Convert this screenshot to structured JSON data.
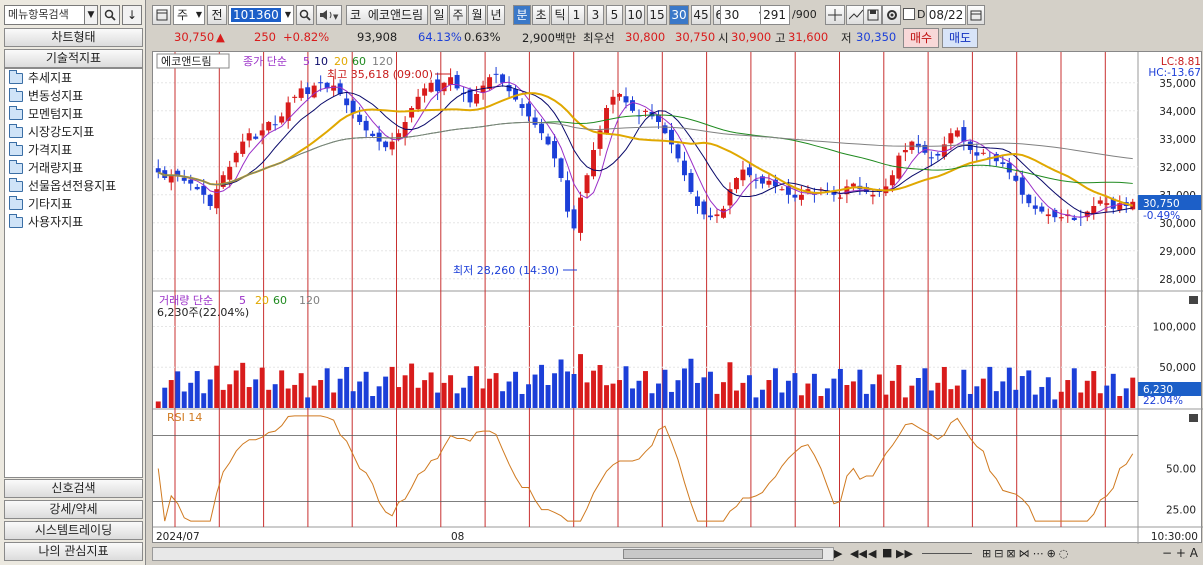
{
  "left_panel": {
    "search_placeholder": "메뉴항목검색",
    "chart_type_label": "차트형태",
    "tech_indicator_label": "기술적지표",
    "tree_items": [
      "추세지표",
      "변동성지표",
      "모멘텀지표",
      "시장강도지표",
      "가격지표",
      "거래량지표",
      "선물옵션전용지표",
      "기타지표",
      "사용자지표"
    ],
    "bottom_buttons": [
      "신호검색",
      "강세/약세",
      "시스템트레이딩",
      "나의 관심지표"
    ]
  },
  "toolbar": {
    "period_select": "주",
    "prev_label": "전",
    "code": "101360",
    "market_prefix": "코",
    "stock_name": "에코앤드림",
    "period_buttons": [
      "일",
      "주",
      "월",
      "년",
      "분",
      "초",
      "틱"
    ],
    "selected_period": "분",
    "minute_buttons": [
      "1",
      "3",
      "5",
      "10",
      "15",
      "30",
      "45",
      "60"
    ],
    "selected_minute": "30",
    "interval_value": "30",
    "count_value": "291",
    "count_total": "/900",
    "date_label": "D",
    "date_value": "08/22"
  },
  "quote": {
    "price": "30,750",
    "change_arrow": "▲",
    "change": "250",
    "change_pct": "+0.82%",
    "volume": "93,908",
    "vol_ratio": "64.13%",
    "turnover": "0.63%",
    "trade_value": "2,900백만",
    "best_label": "최우선",
    "ask": "30,800",
    "bid": "30,750",
    "open_label": "시",
    "open": "30,900",
    "high_label": "고",
    "high": "31,600",
    "low_label": "저",
    "low": "30,350",
    "buy_button": "매수",
    "sell_button": "매도"
  },
  "price_panel": {
    "title": "에코앤드림",
    "ma_label": "종가 단순",
    "ma_periods": [
      "5",
      "10",
      "20",
      "60",
      "120"
    ],
    "max_annotation": "최고 35,618 (09:00)",
    "min_annotation": "최저 28,260 (14:30)",
    "lc": "LC:8.81",
    "hc": "HC:-13.67",
    "y_ticks": [
      "35,000",
      "34,000",
      "33,000",
      "32,000",
      "31,000",
      "30,000",
      "29,000",
      "28,000"
    ],
    "current_price": "30,750",
    "current_pct": "-0.49%"
  },
  "volume_panel": {
    "title": "거래량 단순",
    "ma_periods": [
      "5",
      "20",
      "60",
      "120"
    ],
    "summary": "6,230주(22.04%)",
    "y_ticks": [
      "100,000",
      "50,000"
    ],
    "current": "6,230",
    "current_pct": "22.04%"
  },
  "rsi_panel": {
    "title": "RSI 14",
    "y_ticks": [
      "50.00",
      "25.00"
    ]
  },
  "x_axis": {
    "labels": [
      "2024/07",
      "08"
    ],
    "time": "10:30:00"
  },
  "colors": {
    "up": "#d81c1c",
    "down": "#1c3fd8",
    "ma5": "#9b30c8",
    "ma10": "#0a0a6a",
    "ma20": "#e0a800",
    "ma60": "#1f8a1f",
    "ma120": "#808080",
    "rsi": "#d07a20",
    "highlight": "#3a78c8"
  },
  "chart_data": {
    "type": "candlestick",
    "price_min_visible": 28260,
    "price_max_visible": 35618,
    "ylim": [
      27600,
      35600
    ],
    "closes": [
      31800,
      31600,
      31700,
      31650,
      31500,
      31400,
      31200,
      31000,
      30600,
      31200,
      31700,
      32000,
      32500,
      32900,
      33200,
      33000,
      33300,
      33600,
      33500,
      33800,
      34300,
      34500,
      34800,
      34600,
      34900,
      35000,
      34800,
      34900,
      34600,
      34200,
      33900,
      33600,
      33300,
      33100,
      32900,
      32700,
      32900,
      33200,
      33600,
      34100,
      34500,
      34800,
      35000,
      34700,
      35000,
      35200,
      34800,
      34600,
      34300,
      34600,
      34900,
      35200,
      35300,
      35000,
      34700,
      34400,
      34100,
      33800,
      33500,
      33200,
      32800,
      32300,
      31600,
      30400,
      29800,
      30900,
      31700,
      32600,
      33300,
      34100,
      34500,
      34600,
      34300,
      34000,
      33800,
      34000,
      33800,
      33600,
      33200,
      32800,
      32300,
      31700,
      31100,
      30600,
      30300,
      30200,
      30300,
      30500,
      31200,
      31600,
      31900,
      31700,
      31500,
      31400,
      31500,
      31300,
      31200,
      31000,
      30900,
      31000,
      31200,
      31000,
      31200,
      31100,
      31000,
      30900,
      31300,
      31400,
      31200,
      31100,
      31000,
      31100,
      31300,
      31700,
      32400,
      32600,
      32900,
      32700,
      32500,
      32300,
      32400,
      32800,
      33200,
      33300,
      32900,
      32600,
      32400,
      32500,
      32300,
      32200,
      32100,
      31800,
      31500,
      31000,
      30700,
      30500,
      30400,
      30300,
      30200,
      30200,
      30300,
      30100,
      30200,
      30400,
      30600,
      30800,
      30700,
      30500,
      30700,
      30600,
      30750
    ]
  }
}
